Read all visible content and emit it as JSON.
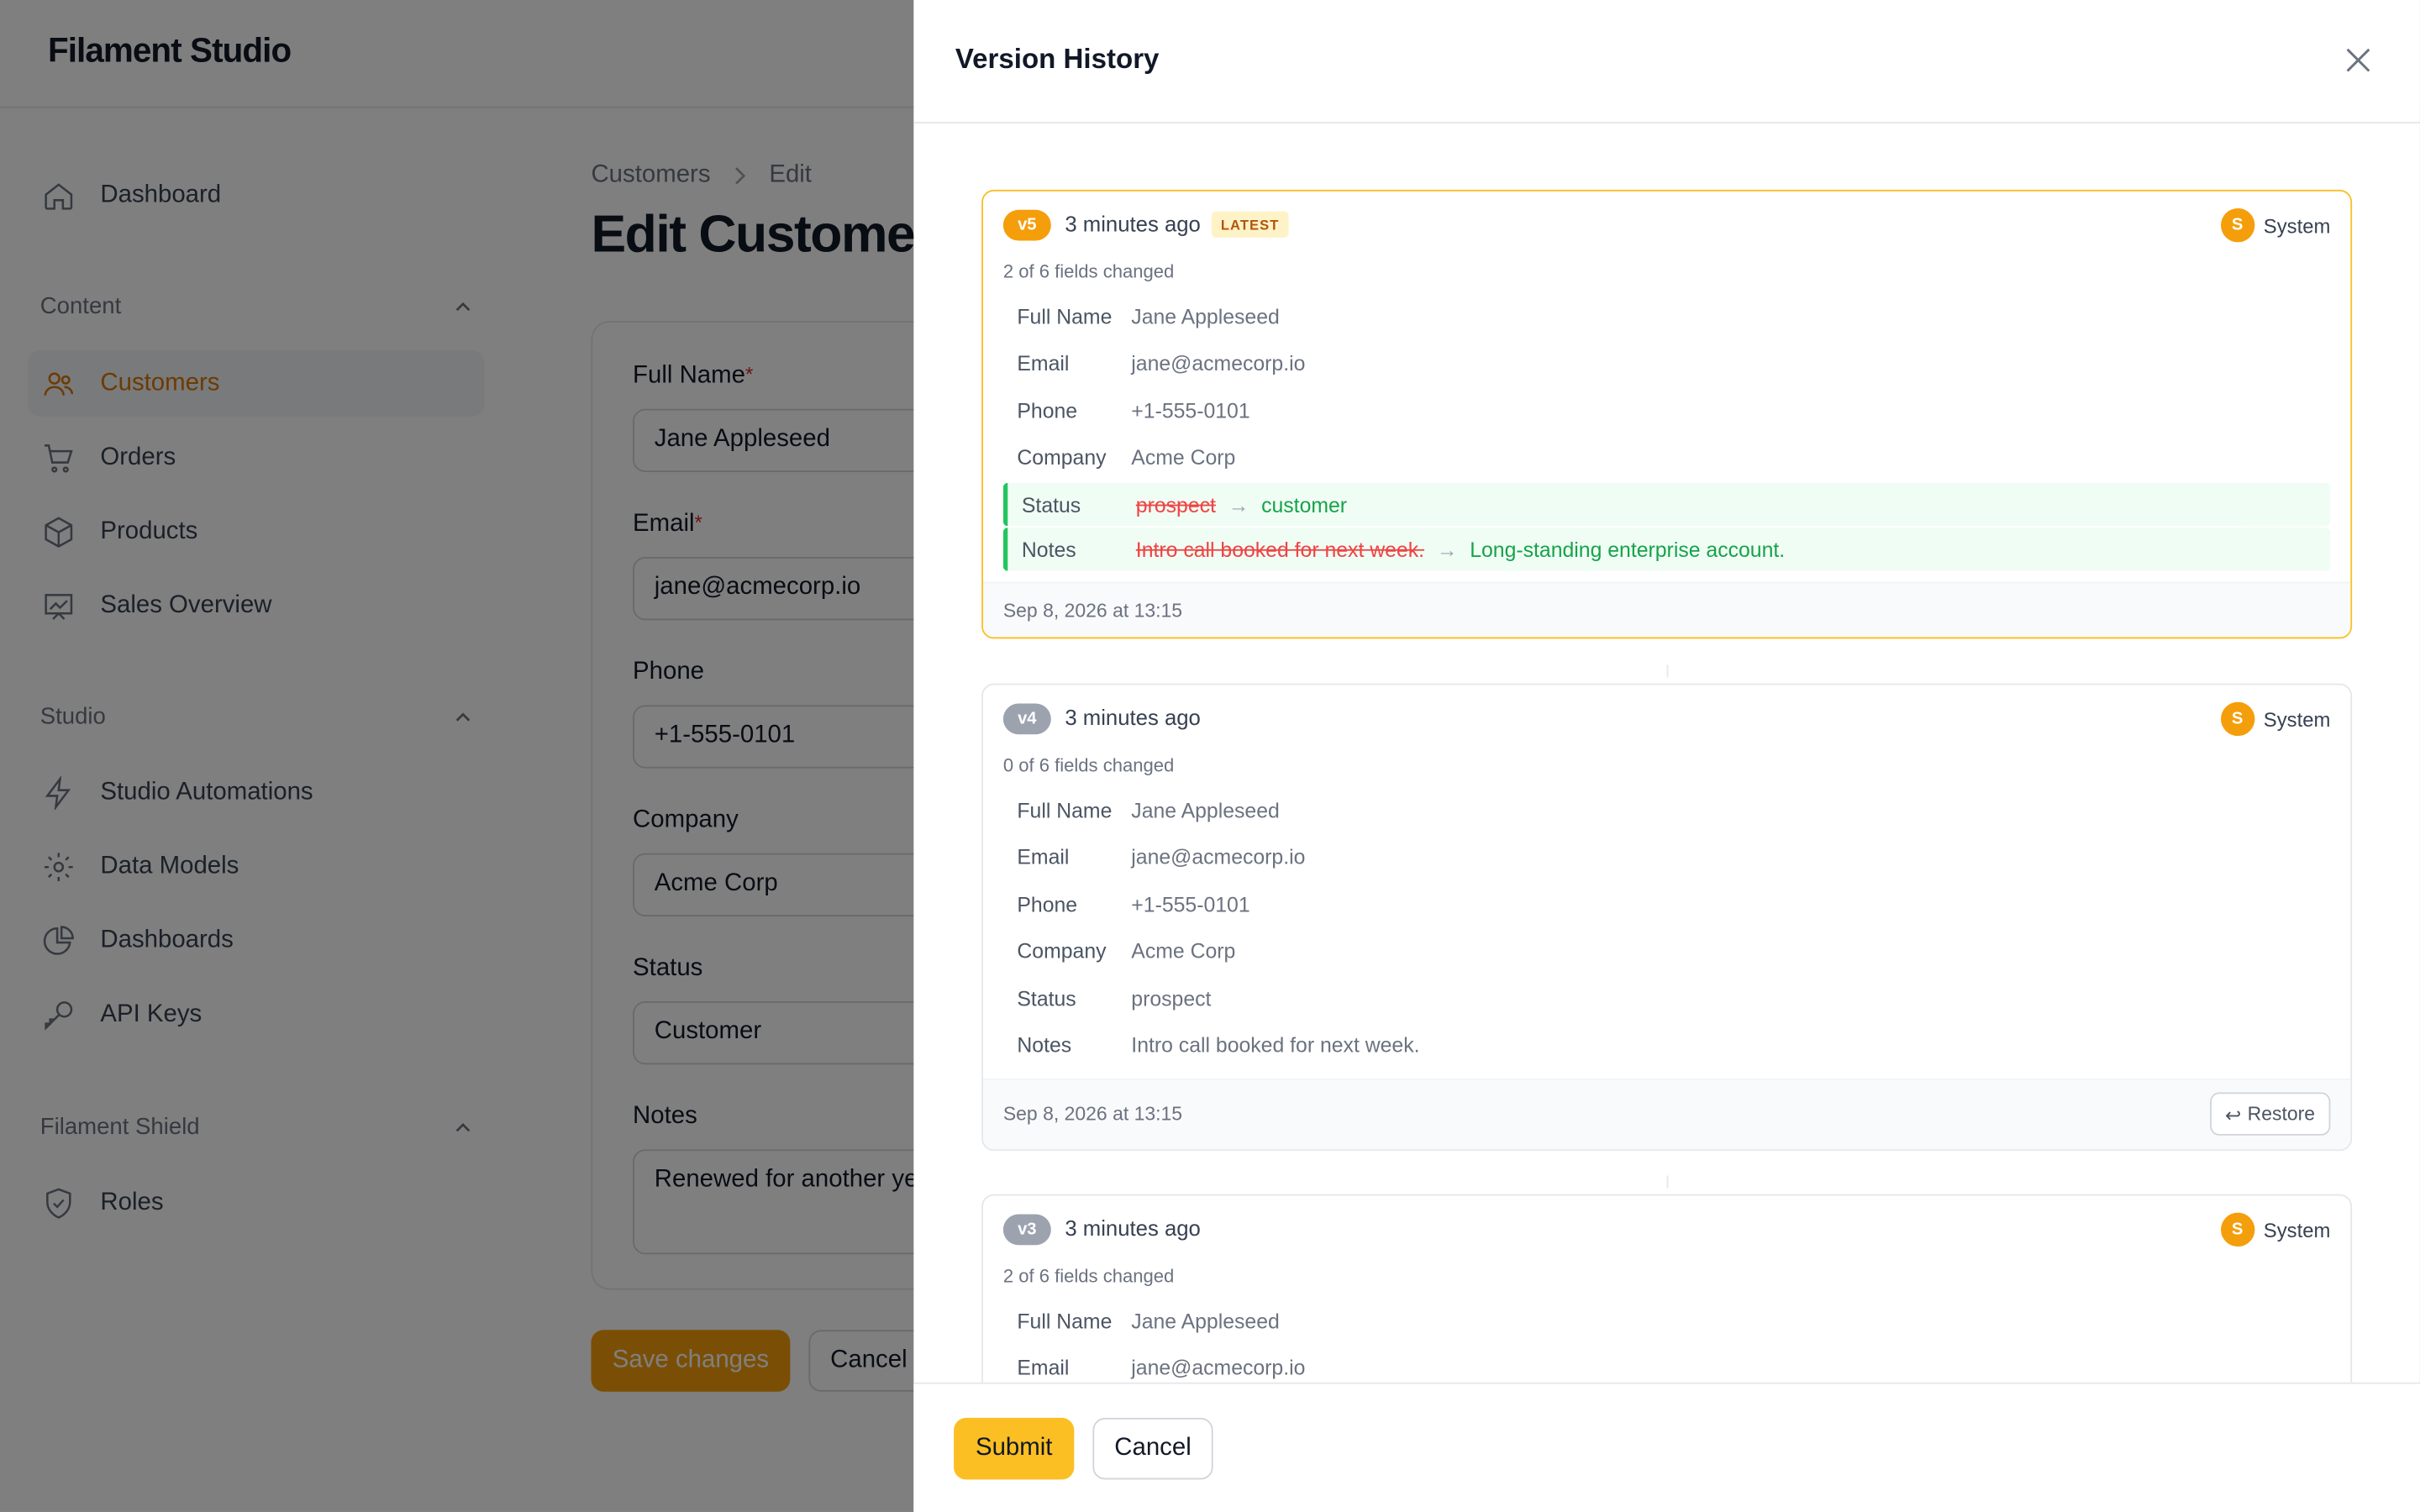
{
  "app": {
    "brand": "Filament Studio"
  },
  "sidebar": {
    "top_items": [
      {
        "label": "Dashboard",
        "icon": "home-icon"
      }
    ],
    "groups": [
      {
        "label": "Content",
        "items": [
          {
            "label": "Customers",
            "icon": "users-icon",
            "active": true
          },
          {
            "label": "Orders",
            "icon": "cart-icon"
          },
          {
            "label": "Products",
            "icon": "cube-icon"
          },
          {
            "label": "Sales Overview",
            "icon": "chart-icon"
          }
        ]
      },
      {
        "label": "Studio",
        "items": [
          {
            "label": "Studio Automations",
            "icon": "bolt-icon"
          },
          {
            "label": "Data Models",
            "icon": "cog-icon"
          },
          {
            "label": "Dashboards",
            "icon": "pie-icon"
          },
          {
            "label": "API Keys",
            "icon": "key-icon"
          }
        ]
      },
      {
        "label": "Filament Shield",
        "items": [
          {
            "label": "Roles",
            "icon": "shield-icon"
          }
        ]
      }
    ]
  },
  "page": {
    "breadcrumb": [
      "Customers",
      "Edit"
    ],
    "title": "Edit Customer",
    "fields": [
      {
        "label": "Full Name",
        "required": true,
        "value": "Jane Appleseed"
      },
      {
        "label": "Email",
        "required": true,
        "value": "jane@acmecorp.io"
      },
      {
        "label": "Phone",
        "required": false,
        "value": "+1-555-0101"
      },
      {
        "label": "Company",
        "required": false,
        "value": "Acme Corp"
      },
      {
        "label": "Status",
        "required": false,
        "value": "Customer"
      },
      {
        "label": "Notes",
        "required": false,
        "value": "Renewed for another year."
      }
    ],
    "save_label": "Save changes",
    "cancel_label": "Cancel"
  },
  "panel": {
    "title": "Version History",
    "submit_label": "Submit",
    "cancel_label": "Cancel",
    "versions": [
      {
        "tag": "v5",
        "time": "3 minutes ago",
        "latest_label": "LATEST",
        "author_initial": "S",
        "author": "System",
        "changed": "2 of 6 fields changed",
        "rows": [
          {
            "name": "Full Name",
            "value": "Jane Appleseed"
          },
          {
            "name": "Email",
            "value": "jane@acmecorp.io"
          },
          {
            "name": "Phone",
            "value": "+1-555-0101"
          },
          {
            "name": "Company",
            "value": "Acme Corp"
          },
          {
            "name": "Status",
            "old": "prospect",
            "new": "customer"
          },
          {
            "name": "Notes",
            "old": "Intro call booked for next week.",
            "new": "Long-standing enterprise account."
          }
        ],
        "date": "Sep 8, 2026 at 13:15"
      },
      {
        "tag": "v4",
        "time": "3 minutes ago",
        "author_initial": "S",
        "author": "System",
        "changed": "0 of 6 fields changed",
        "rows": [
          {
            "name": "Full Name",
            "value": "Jane Appleseed"
          },
          {
            "name": "Email",
            "value": "jane@acmecorp.io"
          },
          {
            "name": "Phone",
            "value": "+1-555-0101"
          },
          {
            "name": "Company",
            "value": "Acme Corp"
          },
          {
            "name": "Status",
            "value": "prospect"
          },
          {
            "name": "Notes",
            "value": "Intro call booked for next week."
          }
        ],
        "date": "Sep 8, 2026 at 13:15",
        "restore_label": "Restore"
      },
      {
        "tag": "v3",
        "time": "3 minutes ago",
        "author_initial": "S",
        "author": "System",
        "changed": "2 of 6 fields changed",
        "rows": [
          {
            "name": "Full Name",
            "value": "Jane Appleseed"
          },
          {
            "name": "Email",
            "value": "jane@acmecorp.io"
          }
        ]
      }
    ]
  },
  "colors": {
    "accent": "#f59e0b",
    "diff_add": "#16a34a",
    "diff_remove": "#ef4444"
  }
}
